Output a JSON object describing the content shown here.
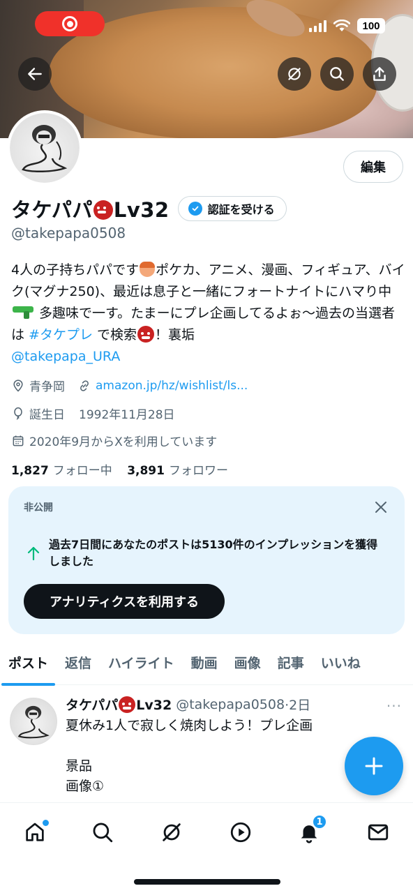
{
  "status_bar": {
    "battery": "100"
  },
  "profile": {
    "display_name": "タケパパ",
    "name_suffix": "Lv32",
    "verify_label": "認証を受ける",
    "edit_label": "編集",
    "handle": "@takepapa0508",
    "bio": {
      "part1": "4人の子持ちパパです",
      "part2": "ポケカ、アニメ、漫画、フィギュア、バイク(マグナ250)、最近は息子と一緒にフォートナイトにハマり中",
      "part3": " 多趣味で一す。たまーにプレ企画してるよぉ〜過去の当選者は ",
      "hashtag": "#タケプレ",
      "part4": " で検索",
      "part5": "！裏垢",
      "mention": "@takepapa_URA"
    },
    "location": "青争岡",
    "website": "amazon.jp/hz/wishlist/ls...",
    "birthday_label": "誕生日",
    "birthday": "1992年11月28日",
    "joined": "2020年9月からXを利用しています",
    "following_count": "1,827",
    "following_label": "フォロー中",
    "followers_count": "3,891",
    "followers_label": "フォロワー"
  },
  "private_card": {
    "label": "非公開",
    "text": "過去7日間にあなたのポストは5130件のインプレッションを獲得しました",
    "button": "アナリティクスを利用する"
  },
  "tabs": [
    "ポスト",
    "返信",
    "ハイライト",
    "動画",
    "画像",
    "記事",
    "いいね"
  ],
  "post": {
    "name": "タケパパ",
    "name_suffix": "Lv32",
    "handle": "@takepapa0508",
    "time": "·2日",
    "line1": "夏休み1人で寂しく焼肉しよう！プレ企画",
    "line2": "景品",
    "line3": "画像①"
  },
  "bottom_nav": {
    "notification_count": "1"
  },
  "colors": {
    "accent": "#1d9bf0",
    "text": "#0f1419",
    "secondary": "#536471",
    "card_bg": "#e6f4fd",
    "record": "#f0312a"
  }
}
